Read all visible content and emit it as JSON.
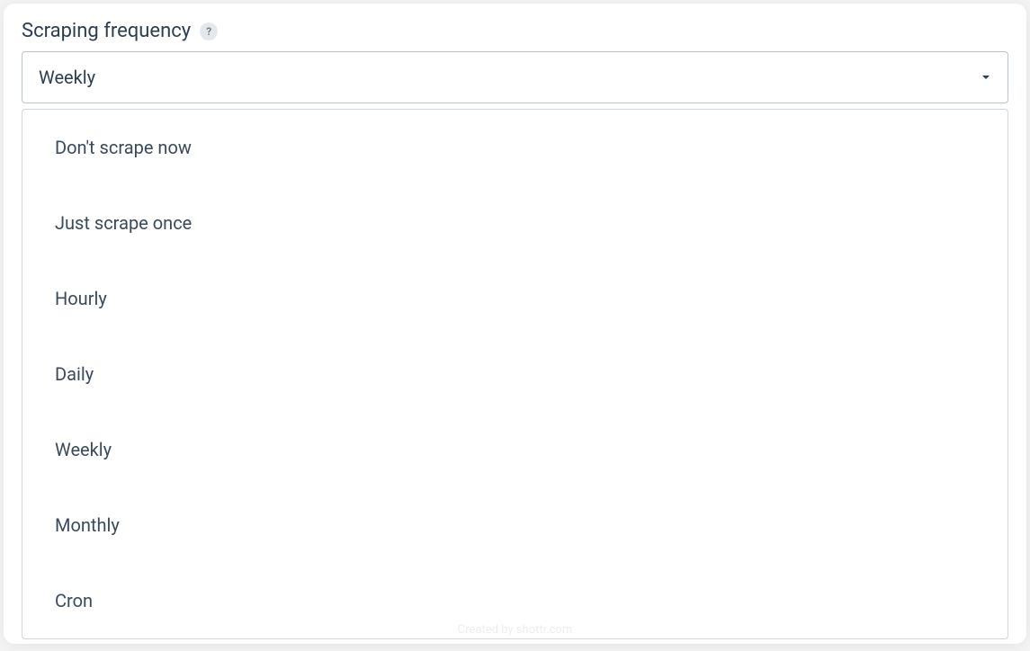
{
  "field": {
    "label": "Scraping frequency",
    "help_glyph": "?",
    "selected": "Weekly"
  },
  "options": [
    "Don't scrape now",
    "Just scrape once",
    "Hourly",
    "Daily",
    "Weekly",
    "Monthly",
    "Cron"
  ],
  "watermark": "Created by shottr.com"
}
